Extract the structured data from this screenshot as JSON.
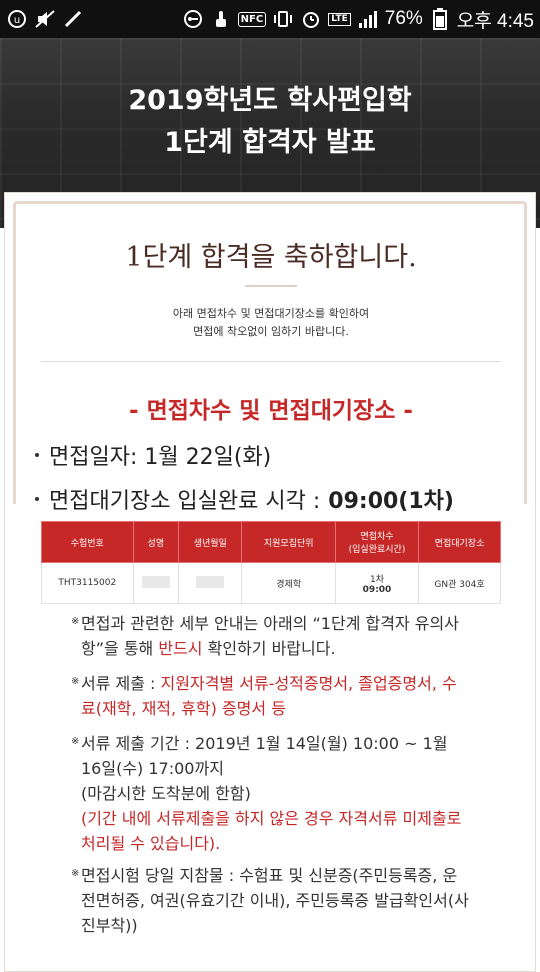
{
  "status_bar": {
    "battery": "76%",
    "time": "오후 4:45",
    "nfc": "NFC",
    "network": "LTE"
  },
  "header": {
    "title_line1": "2019학년도 학사편입학",
    "title_line2": "1단계 합격자 발표"
  },
  "card": {
    "congrats": "1단계 합격을 축하합니다.",
    "notice_line1": "아래 면접차수 및 면접대기장소를 확인하여",
    "notice_line2": "면접에 착오없이 임하기 바랍니다.",
    "section_title": "- 면접차수 및 면접대기장소 -",
    "interview_date_label": "면접일자: 1월 22일(화)",
    "waiting_label": "면접대기장소 입실완료 시각 :",
    "waiting_time": "09:00(1차)",
    "table": {
      "headers": [
        "수험번호",
        "성명",
        "생년월일",
        "지원모집단위",
        "면접차수\n(입실완료시간)",
        "면접대기장소"
      ],
      "header_interview_1": "면접차수",
      "header_interview_2": "(입실완료시간)",
      "row": {
        "exam_no": "THT3115002",
        "major": "경제학",
        "round": "1차",
        "round_time": "09:00",
        "place": "GN관 304호"
      }
    },
    "notes": {
      "n1": "면접과 관련한 세부 안내는 아래의 “1단계 합격자 유의사항”을 통해",
      "n1_red": "반드시",
      "n1_end": "확인하기 바랍니다.",
      "n2_label": "서류 제출 :",
      "n2_red": "지원자격별 서류-성적증명서, 졸업증명서, 수료(재학, 재적, 휴학) 증명서 등",
      "n3_line1": "서류 제출 기간 : 2019년 1월 14일(월) 10:00 ~ 1월 16일(수) 17:00까지",
      "n3_line2": "(마감시한 도착분에 한함)",
      "n3_red": "(기간 내에 서류제출을 하지 않은 경우 자격서류 미제출로 처리될 수 있습니다).",
      "n4": "면접시험 당일 지참물 : 수험표 및 신분증(주민등록증, 운전면허증, 여권(유효기간 이내), 주민등록증 발급확인서(사진부착))",
      "asterisk": "※"
    }
  },
  "colors": {
    "accent_red": "#c62828",
    "banner_bg": "#2b2b2b",
    "title_brown": "#4a2c24"
  }
}
